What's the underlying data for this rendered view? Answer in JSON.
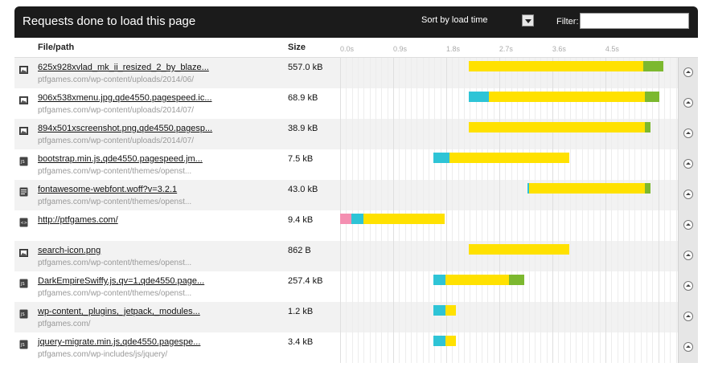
{
  "header": {
    "title": "Requests done to load this page",
    "sort_selected": "Sort by load time",
    "filter_label": "Filter:",
    "filter_value": ""
  },
  "columns": {
    "file": "File/path",
    "size": "Size"
  },
  "timeline": {
    "ticks": [
      {
        "label": "0.0s",
        "time": 0.0
      },
      {
        "label": "0.9s",
        "time": 0.9
      },
      {
        "label": "1.8s",
        "time": 1.8
      },
      {
        "label": "2.7s",
        "time": 2.7
      },
      {
        "label": "3.6s",
        "time": 3.6
      },
      {
        "label": "4.5s",
        "time": 4.5
      }
    ],
    "colors": {
      "pink": "#f48fb1",
      "teal": "#2ec4d6",
      "yellow": "#ffe100",
      "green": "#7cb82f"
    }
  },
  "requests": [
    {
      "icon": "image-icon",
      "name": "625x928xvlad_mk_ii_resized_2_by_blaze...",
      "path": "ptfgames.com/wp-content/uploads/2014/06/",
      "size": "557.0 kB",
      "segments": [
        {
          "color": "yellow",
          "start": 2.18,
          "end": 5.14
        },
        {
          "color": "green",
          "start": 5.14,
          "end": 5.49
        }
      ]
    },
    {
      "icon": "image-icon",
      "name": "906x538xmenu.jpg,qde4550.pagespeed.ic...",
      "path": "ptfgames.com/wp-content/uploads/2014/07/",
      "size": "68.9 kB",
      "segments": [
        {
          "color": "teal",
          "start": 2.18,
          "end": 2.53
        },
        {
          "color": "yellow",
          "start": 2.53,
          "end": 5.17
        },
        {
          "color": "green",
          "start": 5.17,
          "end": 5.42
        }
      ]
    },
    {
      "icon": "image-icon",
      "name": "894x501xscreenshot.png,qde4550.pagesp...",
      "path": "ptfgames.com/wp-content/uploads/2014/07/",
      "size": "38.9 kB",
      "segments": [
        {
          "color": "yellow",
          "start": 2.18,
          "end": 5.17
        },
        {
          "color": "green",
          "start": 5.17,
          "end": 5.26
        }
      ]
    },
    {
      "icon": "js-file-icon",
      "name": "bootstrap.min.js,qde4550.pagespeed.jm...",
      "path": "ptfgames.com/wp-content/themes/openst...",
      "size": "7.5 kB",
      "segments": [
        {
          "color": "teal",
          "start": 1.58,
          "end": 1.86
        },
        {
          "color": "yellow",
          "start": 1.86,
          "end": 3.89
        }
      ]
    },
    {
      "icon": "font-file-icon",
      "name": "fontawesome-webfont.woff?v=3.2.1",
      "path": "ptfgames.com/wp-content/themes/openst...",
      "size": "43.0 kB",
      "segments": [
        {
          "color": "teal",
          "start": 3.18,
          "end": 3.2
        },
        {
          "color": "yellow",
          "start": 3.2,
          "end": 5.17
        },
        {
          "color": "green",
          "start": 5.17,
          "end": 5.26
        }
      ]
    },
    {
      "icon": "html-file-icon",
      "name": "http://ptfgames.com/",
      "path": "",
      "size": "9.4 kB",
      "segments": [
        {
          "color": "pink",
          "start": 0.0,
          "end": 0.19
        },
        {
          "color": "teal",
          "start": 0.19,
          "end": 0.4
        },
        {
          "color": "yellow",
          "start": 0.4,
          "end": 1.77
        }
      ]
    },
    {
      "icon": "image-icon",
      "name": "search-icon.png",
      "path": "ptfgames.com/wp-content/themes/openst...",
      "size": "862 B",
      "segments": [
        {
          "color": "yellow",
          "start": 2.18,
          "end": 3.89
        }
      ]
    },
    {
      "icon": "js-file-icon",
      "name": "DarkEmpireSwiffy.js,qv=1,qde4550.page...",
      "path": "ptfgames.com/wp-content/themes/openst...",
      "size": "257.4 kB",
      "segments": [
        {
          "color": "teal",
          "start": 1.58,
          "end": 1.79
        },
        {
          "color": "yellow",
          "start": 1.79,
          "end": 2.86
        },
        {
          "color": "green",
          "start": 2.86,
          "end": 3.12
        }
      ]
    },
    {
      "icon": "js-file-icon",
      "name": "wp-content,_plugins,_jetpack,_modules...",
      "path": "ptfgames.com/",
      "size": "1.2 kB",
      "segments": [
        {
          "color": "teal",
          "start": 1.58,
          "end": 1.79
        },
        {
          "color": "yellow",
          "start": 1.79,
          "end": 1.96
        }
      ]
    },
    {
      "icon": "js-file-icon",
      "name": "jquery-migrate.min.js,qde4550.pagespe...",
      "path": "ptfgames.com/wp-includes/js/jquery/",
      "size": "3.4 kB",
      "segments": [
        {
          "color": "teal",
          "start": 1.58,
          "end": 1.79
        },
        {
          "color": "yellow",
          "start": 1.79,
          "end": 1.96
        }
      ]
    }
  ]
}
